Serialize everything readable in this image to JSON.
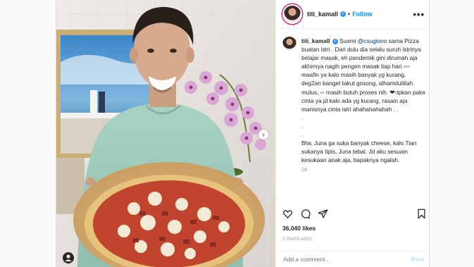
{
  "post": {
    "username": "titi_kamall",
    "follow_label": "Follow",
    "more_label": "•••",
    "caption_username": "titi_kamall",
    "caption_lead": " Suami ",
    "caption_mention": "@csugiono",
    "caption_body": " sama Pizza buatan istri . Dari dulu dia selalu suruh istrinya belajar masak, eh pandemik gini dirumah aja akhirnya nagih pengen masak tiap hari ▫▫▫ maafin ya kalo masih banyak yg kurang, deg2an banget takut gosong, alhamdulillah mulus, ▫▫ masih butuh proses nih. ❤▫tpkan pake cinta ya jd kalo ada yg kurang, rasain aja manisnya cinta istri ahahahahahah . .\n.\n.\n.\nBtw, Juna ga suka banyak cheese, kalo Tian sukanya tipis, Juna tebal. Jd aku sesuain kesukaan anak aja, bapaknya ngalah.",
    "caption_time": "2d",
    "likes": "36,040 likes",
    "date": "2 DAYS AGO",
    "comment_placeholder": "Add a comment...",
    "post_label": "Post",
    "next_label": "›"
  },
  "colors": {
    "accent": "#0095f6",
    "verified": "#3897f0",
    "story_ring": "#c72c7c"
  },
  "icons": [
    "heart-icon",
    "comment-icon",
    "share-icon",
    "bookmark-icon",
    "tag-user-icon",
    "verified-icon",
    "chevron-right-icon"
  ]
}
